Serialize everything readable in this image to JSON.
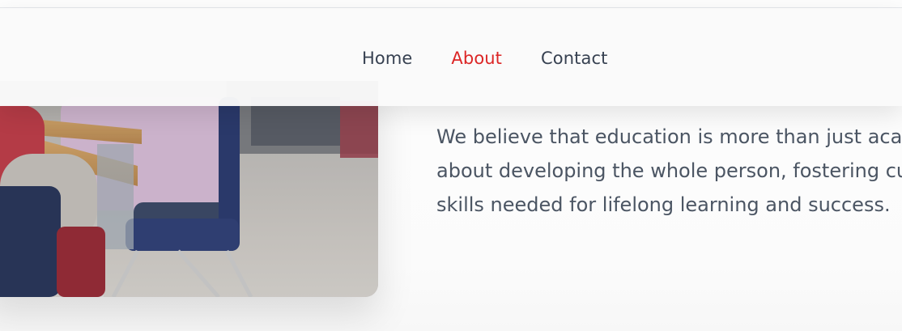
{
  "nav": {
    "items": [
      {
        "label": "Home",
        "active": false
      },
      {
        "label": "About",
        "active": true
      },
      {
        "label": "Contact",
        "active": false
      }
    ],
    "active_color": "#dc2626",
    "default_color": "#374151"
  },
  "content": {
    "paragraph_lines": [
      "We believe that education is more than just acad",
      "about developing the whole person, fostering cu",
      "skills needed for lifelong learning and success."
    ],
    "text_color": "#4b5563"
  },
  "image": {
    "description": "classroom-students-at-desks-photo"
  }
}
